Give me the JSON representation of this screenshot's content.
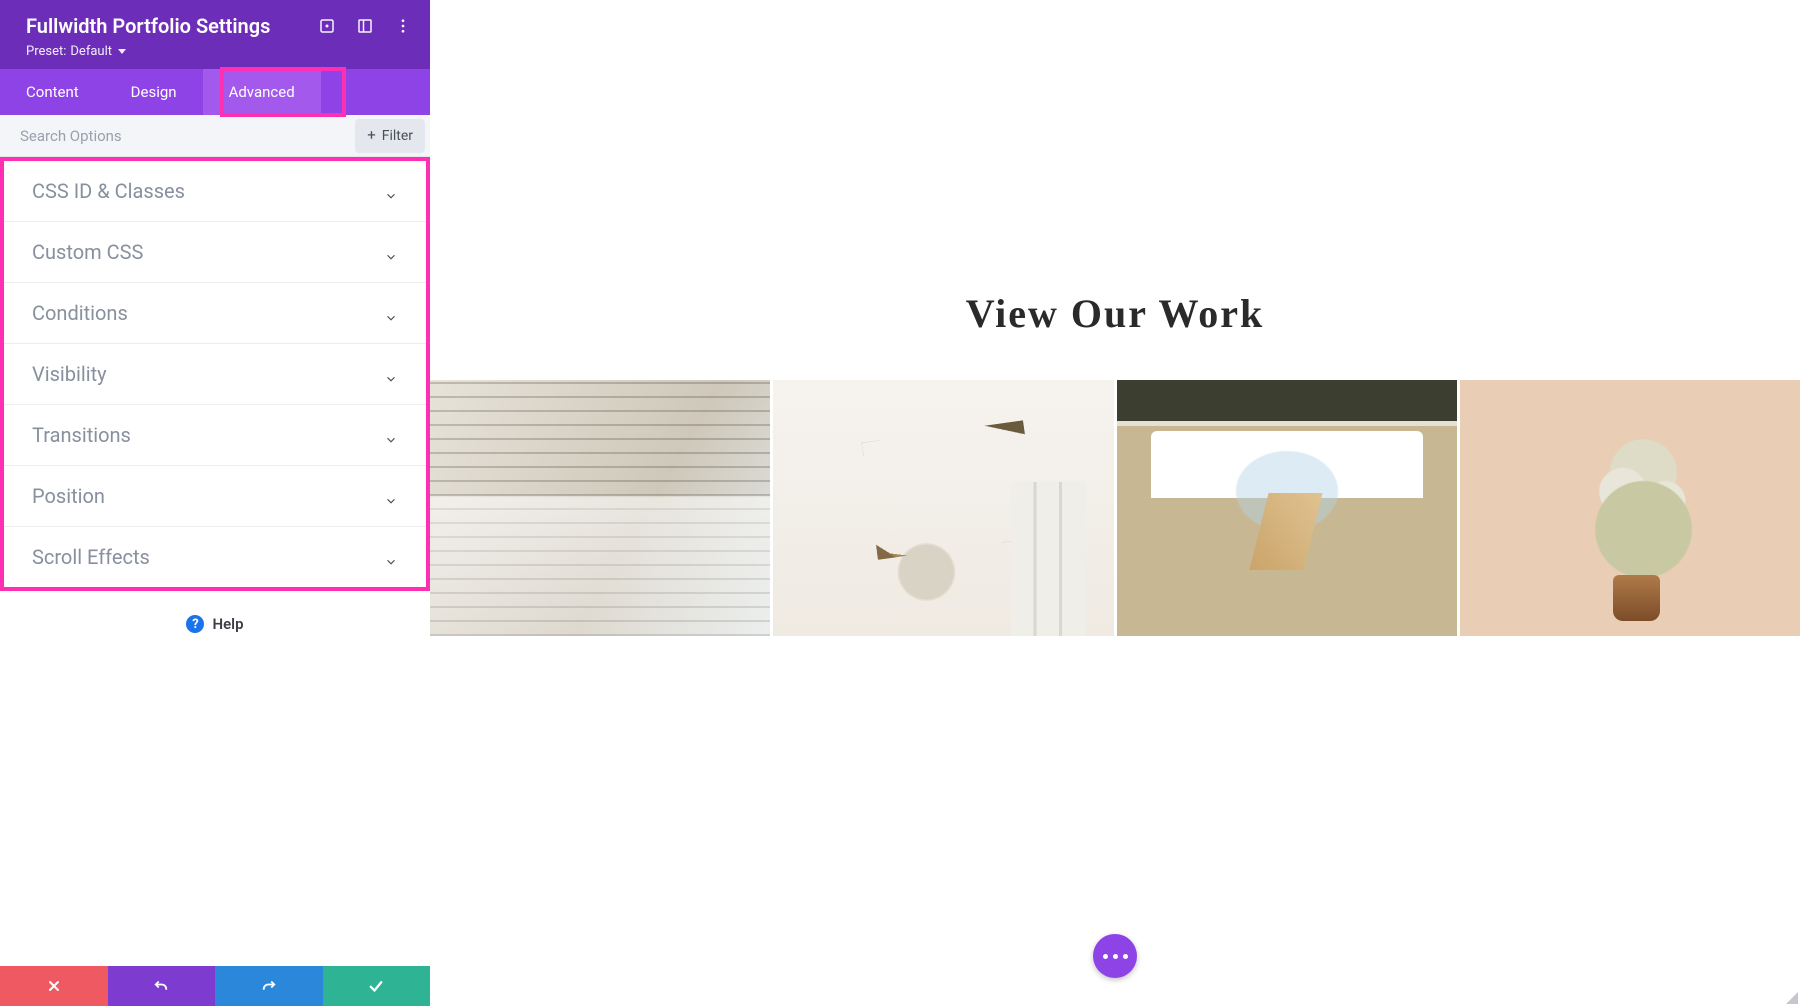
{
  "panel": {
    "title": "Fullwidth Portfolio Settings",
    "preset_prefix": "Preset:",
    "preset_value": "Default"
  },
  "tabs": {
    "content": "Content",
    "design": "Design",
    "advanced": "Advanced",
    "active": "advanced"
  },
  "search": {
    "placeholder": "Search Options",
    "filter_label": "Filter"
  },
  "sections": [
    "CSS ID & Classes",
    "Custom CSS",
    "Conditions",
    "Visibility",
    "Transitions",
    "Position",
    "Scroll Effects"
  ],
  "help_label": "Help",
  "preview": {
    "heading": "View Our Work"
  },
  "colors": {
    "header_bg": "#6c2eb9",
    "tabs_bg": "#8e43e7",
    "tab_active_bg": "#a259ec",
    "highlight": "#ff2fb3",
    "danger": "#ef5a62",
    "undo": "#7e3bd0",
    "redo": "#2b87da",
    "confirm": "#2fb395"
  }
}
